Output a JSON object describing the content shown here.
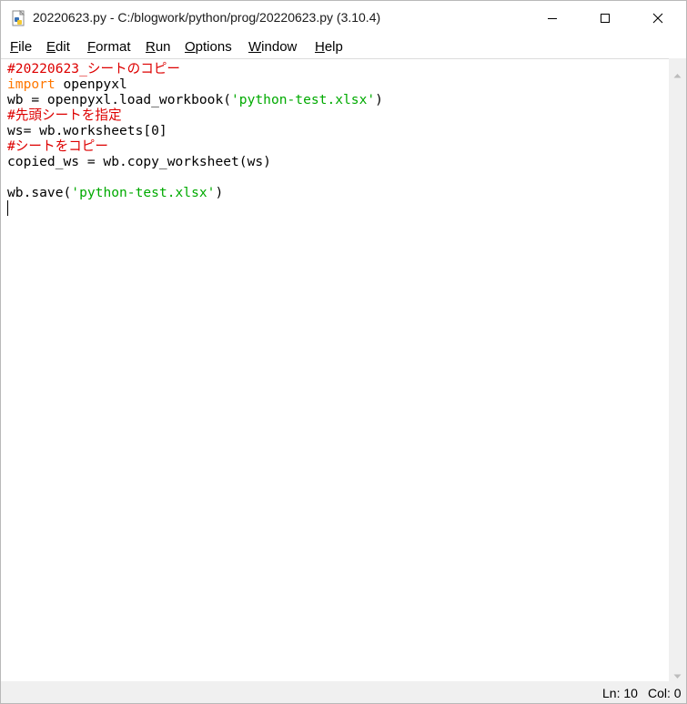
{
  "window": {
    "title": "20220623.py - C:/blogwork/python/prog/20220623.py (3.10.4)"
  },
  "menu": {
    "file": "File",
    "edit": "Edit",
    "format": "Format",
    "run": "Run",
    "options": "Options",
    "window": "Window",
    "help": "Help"
  },
  "editor": {
    "lines": [
      [
        {
          "t": "#20220623_シートのコピー",
          "k": "comment"
        }
      ],
      [
        {
          "t": "import",
          "k": "kw"
        },
        {
          "t": " openpyxl",
          "k": "plain"
        }
      ],
      [
        {
          "t": "wb = openpyxl.load_workbook(",
          "k": "plain"
        },
        {
          "t": "'python-test.xlsx'",
          "k": "str"
        },
        {
          "t": ")",
          "k": "plain"
        }
      ],
      [
        {
          "t": "#先頭シートを指定",
          "k": "comment"
        }
      ],
      [
        {
          "t": "ws= wb.worksheets[0]",
          "k": "plain"
        }
      ],
      [
        {
          "t": "#シートをコピー",
          "k": "comment"
        }
      ],
      [
        {
          "t": "copied_ws = wb.copy_worksheet(ws)",
          "k": "plain"
        }
      ],
      [
        {
          "t": "",
          "k": "plain"
        }
      ],
      [
        {
          "t": "wb.save(",
          "k": "plain"
        },
        {
          "t": "'python-test.xlsx'",
          "k": "str"
        },
        {
          "t": ")",
          "k": "plain"
        }
      ],
      [
        {
          "t": "",
          "k": "plain"
        }
      ]
    ]
  },
  "status": {
    "line": "Ln: 10",
    "col": "Col: 0"
  },
  "colors": {
    "comment": "#dd0000",
    "keyword": "#ff7700",
    "string": "#00aa00"
  }
}
